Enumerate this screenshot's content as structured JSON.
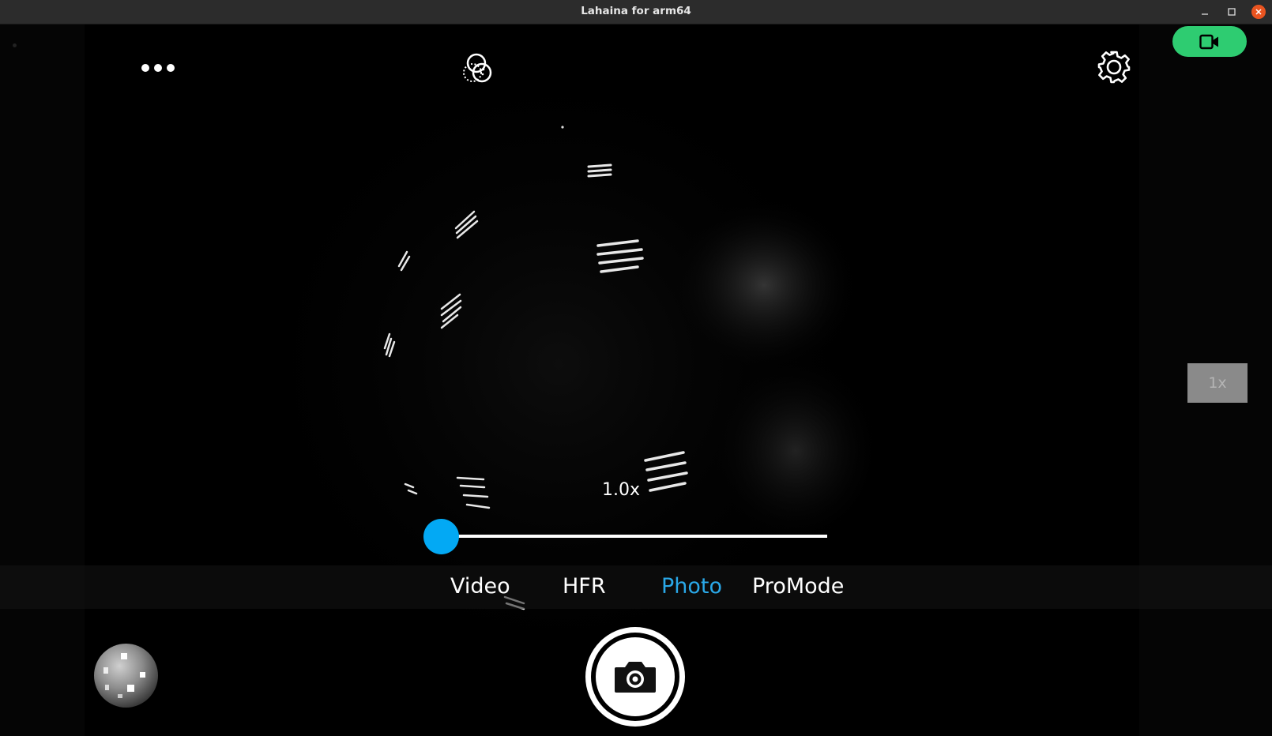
{
  "window": {
    "title": "Lahaina for arm64"
  },
  "camera": {
    "zoom_text": "1.0x",
    "zoom_level": 1.0,
    "zoom_slider_fraction": 0.0,
    "lens_button": "1x",
    "modes": [
      {
        "label": "Video",
        "active": false
      },
      {
        "label": "HFR",
        "active": false
      },
      {
        "label": "Photo",
        "active": true
      },
      {
        "label": "ProMode",
        "active": false
      }
    ]
  },
  "icons": {
    "more": "more-dots-icon",
    "filter": "color-filter-icon",
    "settings": "gear-icon",
    "record": "video-camera-icon",
    "shutter": "camera-icon",
    "gallery": "gallery-thumbnail"
  },
  "colors": {
    "accent": "#03a9f4",
    "active_mode": "#2aa8e8",
    "record_button": "#2ecc71",
    "close_button": "#e95420",
    "titlebar": "#2c2c2c"
  }
}
